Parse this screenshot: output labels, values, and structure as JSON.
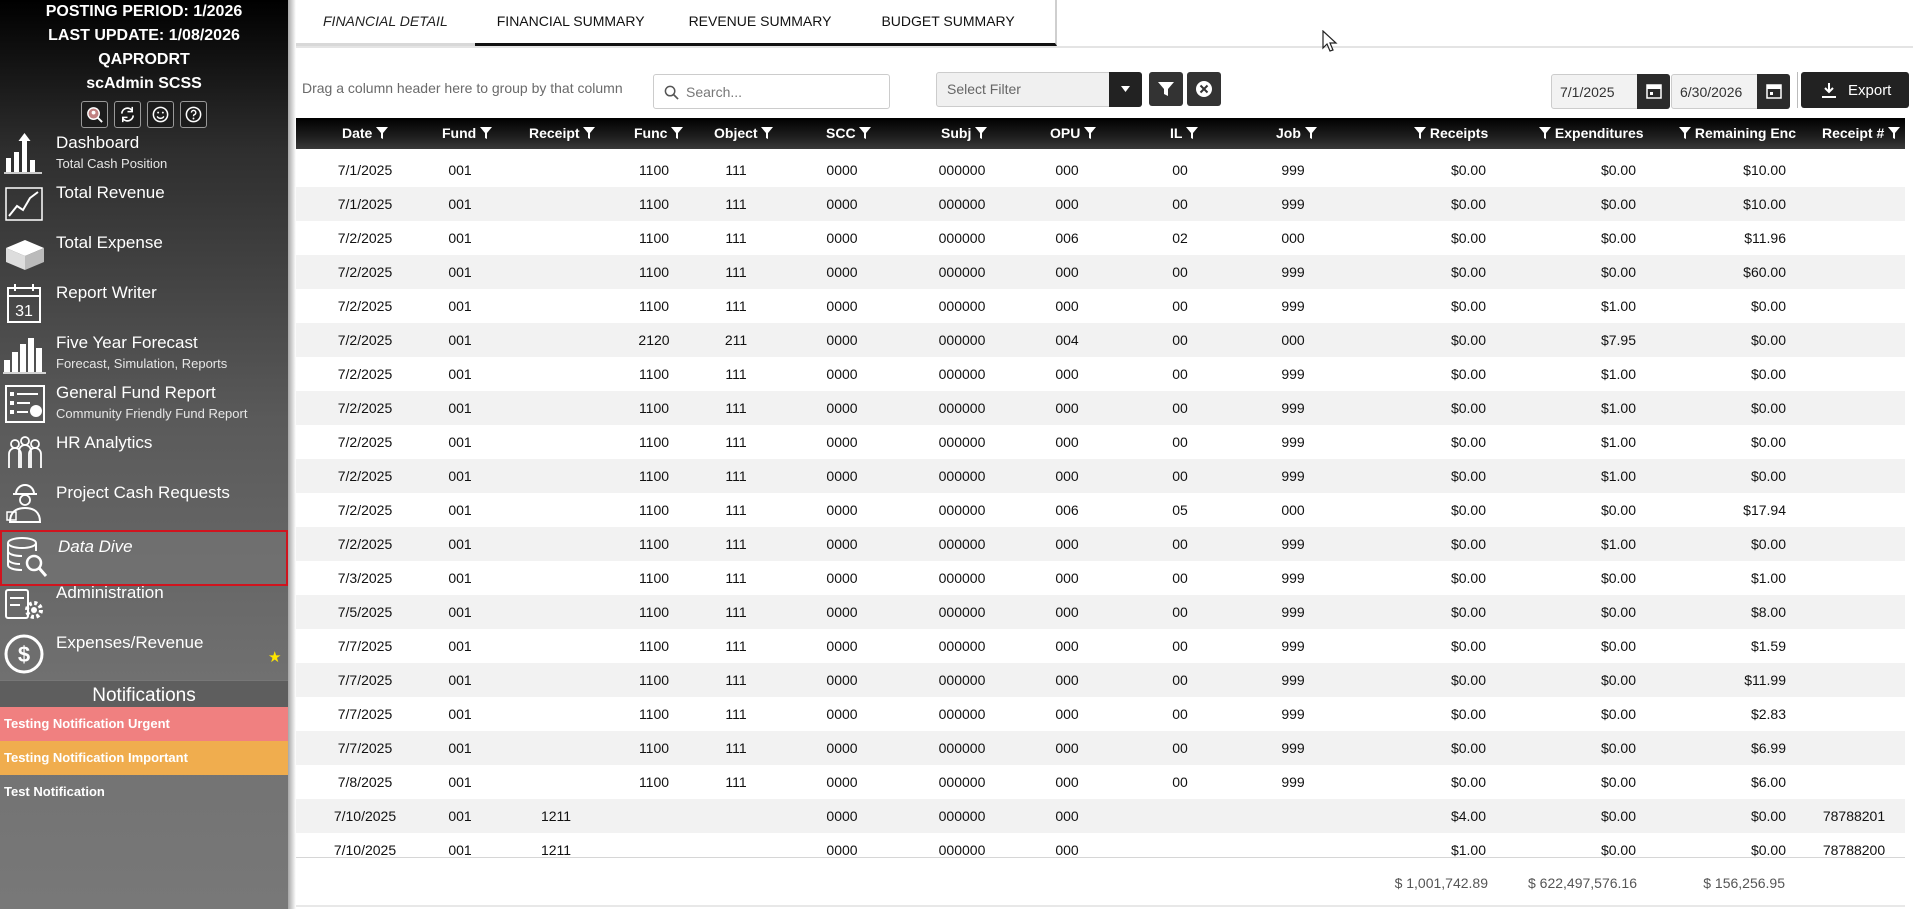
{
  "sidebar": {
    "posting_period": "POSTING PERIOD: 1/2026",
    "last_update": "LAST UPDATE: 1/08/2026",
    "environment": "QAPRODRT",
    "user": "scAdmin SCSS",
    "tool_icons": [
      "search-user-icon",
      "refresh-icon",
      "smiley-icon",
      "help-icon"
    ],
    "nav": [
      {
        "label": "Dashboard",
        "sub": "Total Cash Position",
        "icon": "bar-arrow-icon"
      },
      {
        "label": "Total Revenue",
        "sub": "",
        "icon": "line-chart-icon"
      },
      {
        "label": "Total Expense",
        "sub": "",
        "icon": "open-box-icon"
      },
      {
        "label": "Report Writer",
        "sub": "",
        "icon": "calendar-icon"
      },
      {
        "label": "Five Year Forecast",
        "sub": "Forecast, Simulation, Reports",
        "icon": "city-bars-icon"
      },
      {
        "label": "General Fund Report",
        "sub": "Community Friendly Fund Report",
        "icon": "report-icon"
      },
      {
        "label": "HR Analytics",
        "sub": "",
        "icon": "people-icon"
      },
      {
        "label": "Project Cash Requests",
        "sub": "",
        "icon": "worker-icon"
      },
      {
        "label": "Data Dive",
        "sub": "",
        "icon": "database-search-icon",
        "active": true
      },
      {
        "label": "Administration",
        "sub": "",
        "icon": "admin-gear-icon"
      },
      {
        "label": "Expenses/Revenue",
        "sub": "",
        "icon": "dollar-circle-icon",
        "star": true
      }
    ],
    "notifications_title": "Notifications",
    "notifications": [
      {
        "text": "Testing Notification Urgent",
        "color": "#f08080"
      },
      {
        "text": "Testing Notification Important",
        "color": "#f0ad4e"
      },
      {
        "text": "Test Notification",
        "color": ""
      }
    ]
  },
  "tabs": [
    "FINANCIAL DETAIL",
    "FINANCIAL SUMMARY",
    "REVENUE SUMMARY",
    "BUDGET SUMMARY"
  ],
  "toolbar": {
    "group_hint": "Drag a column header here to group by that column",
    "search_placeholder": "Search...",
    "filter_placeholder": "Select Filter",
    "date_from": "7/1/2025",
    "date_to": "6/30/2026",
    "export_label": "Export"
  },
  "grid": {
    "columns": [
      "Date",
      "Fund",
      "Receipt",
      "Func",
      "Object",
      "SCC",
      "Subj",
      "OPU",
      "IL",
      "Job",
      "Receipts",
      "Expenditures",
      "Remaining Enc",
      "Receipt #"
    ],
    "rows": [
      [
        "7/1/2025",
        "001",
        "",
        "1100",
        "111",
        "0000",
        "000000",
        "000",
        "00",
        "999",
        "$0.00",
        "$0.00",
        "$10.00",
        ""
      ],
      [
        "7/1/2025",
        "001",
        "",
        "1100",
        "111",
        "0000",
        "000000",
        "000",
        "00",
        "999",
        "$0.00",
        "$0.00",
        "$10.00",
        ""
      ],
      [
        "7/2/2025",
        "001",
        "",
        "1100",
        "111",
        "0000",
        "000000",
        "006",
        "02",
        "000",
        "$0.00",
        "$0.00",
        "$11.96",
        ""
      ],
      [
        "7/2/2025",
        "001",
        "",
        "1100",
        "111",
        "0000",
        "000000",
        "000",
        "00",
        "999",
        "$0.00",
        "$0.00",
        "$60.00",
        ""
      ],
      [
        "7/2/2025",
        "001",
        "",
        "1100",
        "111",
        "0000",
        "000000",
        "000",
        "00",
        "999",
        "$0.00",
        "$1.00",
        "$0.00",
        ""
      ],
      [
        "7/2/2025",
        "001",
        "",
        "2120",
        "211",
        "0000",
        "000000",
        "004",
        "00",
        "000",
        "$0.00",
        "$7.95",
        "$0.00",
        ""
      ],
      [
        "7/2/2025",
        "001",
        "",
        "1100",
        "111",
        "0000",
        "000000",
        "000",
        "00",
        "999",
        "$0.00",
        "$1.00",
        "$0.00",
        ""
      ],
      [
        "7/2/2025",
        "001",
        "",
        "1100",
        "111",
        "0000",
        "000000",
        "000",
        "00",
        "999",
        "$0.00",
        "$1.00",
        "$0.00",
        ""
      ],
      [
        "7/2/2025",
        "001",
        "",
        "1100",
        "111",
        "0000",
        "000000",
        "000",
        "00",
        "999",
        "$0.00",
        "$1.00",
        "$0.00",
        ""
      ],
      [
        "7/2/2025",
        "001",
        "",
        "1100",
        "111",
        "0000",
        "000000",
        "000",
        "00",
        "999",
        "$0.00",
        "$1.00",
        "$0.00",
        ""
      ],
      [
        "7/2/2025",
        "001",
        "",
        "1100",
        "111",
        "0000",
        "000000",
        "006",
        "05",
        "000",
        "$0.00",
        "$0.00",
        "$17.94",
        ""
      ],
      [
        "7/2/2025",
        "001",
        "",
        "1100",
        "111",
        "0000",
        "000000",
        "000",
        "00",
        "999",
        "$0.00",
        "$1.00",
        "$0.00",
        ""
      ],
      [
        "7/3/2025",
        "001",
        "",
        "1100",
        "111",
        "0000",
        "000000",
        "000",
        "00",
        "999",
        "$0.00",
        "$0.00",
        "$1.00",
        ""
      ],
      [
        "7/5/2025",
        "001",
        "",
        "1100",
        "111",
        "0000",
        "000000",
        "000",
        "00",
        "999",
        "$0.00",
        "$0.00",
        "$8.00",
        ""
      ],
      [
        "7/7/2025",
        "001",
        "",
        "1100",
        "111",
        "0000",
        "000000",
        "000",
        "00",
        "999",
        "$0.00",
        "$0.00",
        "$1.59",
        ""
      ],
      [
        "7/7/2025",
        "001",
        "",
        "1100",
        "111",
        "0000",
        "000000",
        "000",
        "00",
        "999",
        "$0.00",
        "$0.00",
        "$11.99",
        ""
      ],
      [
        "7/7/2025",
        "001",
        "",
        "1100",
        "111",
        "0000",
        "000000",
        "000",
        "00",
        "999",
        "$0.00",
        "$0.00",
        "$2.83",
        ""
      ],
      [
        "7/7/2025",
        "001",
        "",
        "1100",
        "111",
        "0000",
        "000000",
        "000",
        "00",
        "999",
        "$0.00",
        "$0.00",
        "$6.99",
        ""
      ],
      [
        "7/8/2025",
        "001",
        "",
        "1100",
        "111",
        "0000",
        "000000",
        "000",
        "00",
        "999",
        "$0.00",
        "$0.00",
        "$6.00",
        ""
      ],
      [
        "7/10/2025",
        "001",
        "1211",
        "",
        "",
        "0000",
        "000000",
        "000",
        "",
        "",
        "$4.00",
        "$0.00",
        "$0.00",
        "78788201"
      ],
      [
        "7/10/2025",
        "001",
        "1211",
        "",
        "",
        "0000",
        "000000",
        "000",
        "",
        "",
        "$1.00",
        "$0.00",
        "$0.00",
        "78788200"
      ]
    ],
    "totals": {
      "receipts": "$ 1,001,742.89",
      "expenditures": "$ 622,497,576.16",
      "remaining_enc": "$ 156,256.95"
    }
  },
  "colors": {
    "active_nav_border": "#d0141e",
    "urgent": "#f08080",
    "important": "#f0ad4e",
    "star": "#ffe600"
  }
}
